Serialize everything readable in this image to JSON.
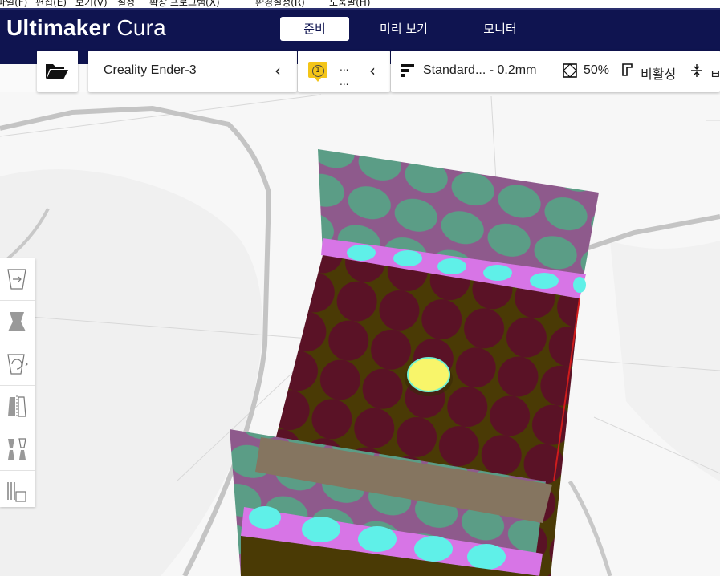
{
  "menubar": {
    "items": [
      "파일(F)",
      "편집(E)",
      "보기(V)",
      "설정",
      "확장 프로그램(X)",
      "환경설정(R)",
      "도움말(H)"
    ]
  },
  "header": {
    "logo_bold": "Ultimaker",
    "logo_light": "Cura",
    "tabs": [
      {
        "label": "준비",
        "active": true
      },
      {
        "label": "미리 보기",
        "active": false
      },
      {
        "label": "모니터",
        "active": false
      }
    ]
  },
  "toolbar": {
    "open_file_icon": "folder-open-icon",
    "printer_name": "Creality Ender-3",
    "material_badge": "1",
    "material_dots_top": "...",
    "material_dots_bottom": "...",
    "profile": "Standard... - 0.2mm",
    "infill": "50%",
    "support": "비활성",
    "adhesion": "ㅂ"
  },
  "tools": [
    {
      "name": "move-tool",
      "icon": "move-icon"
    },
    {
      "name": "scale-tool",
      "icon": "scale-icon"
    },
    {
      "name": "rotate-tool",
      "icon": "rotate-icon"
    },
    {
      "name": "mirror-tool",
      "icon": "mirror-icon"
    },
    {
      "name": "per-model-settings-tool",
      "icon": "per-model-settings-icon"
    },
    {
      "name": "support-blocker-tool",
      "icon": "support-blocker-icon"
    }
  ],
  "colors": {
    "header_bg": "#0f1450",
    "accent_yellow": "#f4c518",
    "model_dark": "#5a1226",
    "model_teal": "#5b9d86",
    "model_purple": "#8e5a8c",
    "stripe_cyan": "#5ff0e8",
    "stripe_magenta": "#d775e6"
  }
}
